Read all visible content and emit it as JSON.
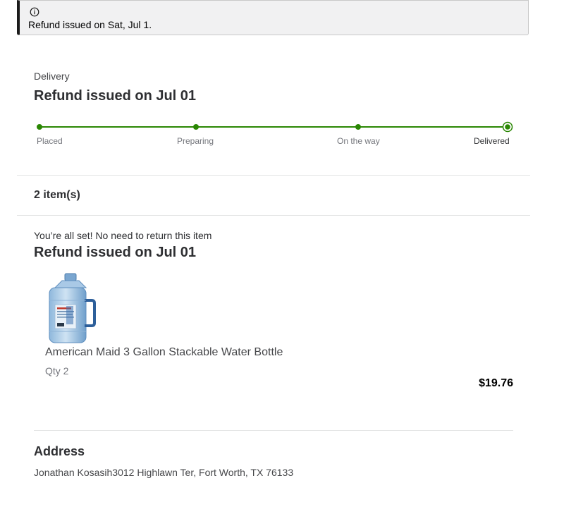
{
  "alert": {
    "icon": "info-icon",
    "message": "Refund issued on Sat, Jul 1."
  },
  "delivery": {
    "label": "Delivery",
    "status_heading": "Refund issued on Jul 01",
    "accent_color": "#2a8703",
    "steps": [
      {
        "label": "Placed",
        "state": "complete"
      },
      {
        "label": "Preparing",
        "state": "complete"
      },
      {
        "label": "On the way",
        "state": "complete"
      },
      {
        "label": "Delivered",
        "state": "current"
      }
    ]
  },
  "items": {
    "count_label": "2 item(s)",
    "return_note": "You’re all set! No need to return this item",
    "status_heading": "Refund issued on Jul 01",
    "list": [
      {
        "name": "American Maid 3 Gallon Stackable Water Bottle",
        "qty": "Qty 2",
        "price": "$19.76",
        "image_icon": "water-bottle-image"
      }
    ]
  },
  "address": {
    "heading": "Address",
    "text": "Jonathan Kosasih3012 Highlawn Ter, Fort Worth, TX 76133"
  }
}
